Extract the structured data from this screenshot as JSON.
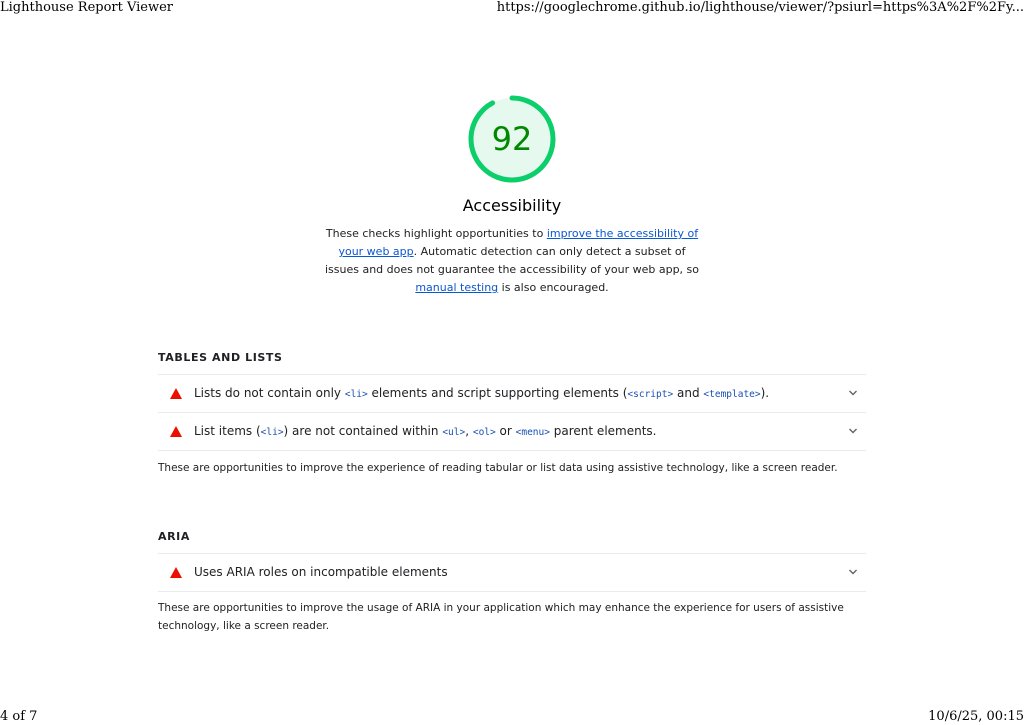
{
  "print": {
    "header_title": "Lighthouse Report Viewer",
    "header_url": "https://googlechrome.github.io/lighthouse/viewer/?psiurl=https%3A%2F%2Fy...",
    "footer_page": "4 of 7",
    "footer_datetime": "10/6/25, 00:15"
  },
  "category": {
    "score": "92",
    "score_fraction": 0.92,
    "score_color": "#0cce6b",
    "score_text_color": "#008800",
    "title": "Accessibility",
    "desc_part1": "These checks highlight opportunities to ",
    "desc_link1": "improve the accessibility of your web app",
    "desc_part2": ". Automatic detection can only detect a subset of issues and does not guarantee the accessibility of your web app, so ",
    "desc_link2": "manual testing",
    "desc_part3": " is also encouraged."
  },
  "groups": {
    "tables": {
      "title": "TABLES AND LISTS",
      "audit1": {
        "icon": "fail-triangle-icon",
        "t1": "Lists do not contain only ",
        "c1": "<li>",
        "t2": " elements and script supporting elements (",
        "c2": "<script>",
        "t3": " and ",
        "c3": "<template>",
        "t4": ")."
      },
      "audit2": {
        "icon": "fail-triangle-icon",
        "t1": "List items (",
        "c1": "<li>",
        "t2": ") are not contained within ",
        "c2": "<ul>",
        "t3": ", ",
        "c3": "<ol>",
        "t4": " or ",
        "c4": "<menu>",
        "t5": " parent elements."
      },
      "description": "These are opportunities to improve the experience of reading tabular or list data using assistive technology, like a screen reader."
    },
    "aria": {
      "title": "ARIA",
      "audit1": {
        "icon": "fail-triangle-icon",
        "label": "Uses ARIA roles on incompatible elements"
      },
      "description": "These are opportunities to improve the usage of ARIA in your application which may enhance the experience for users of assistive technology, like a screen reader."
    }
  },
  "colors": {
    "fail": "#eb0f00",
    "pass": "#0cce6b",
    "link": "#0b57d0"
  }
}
